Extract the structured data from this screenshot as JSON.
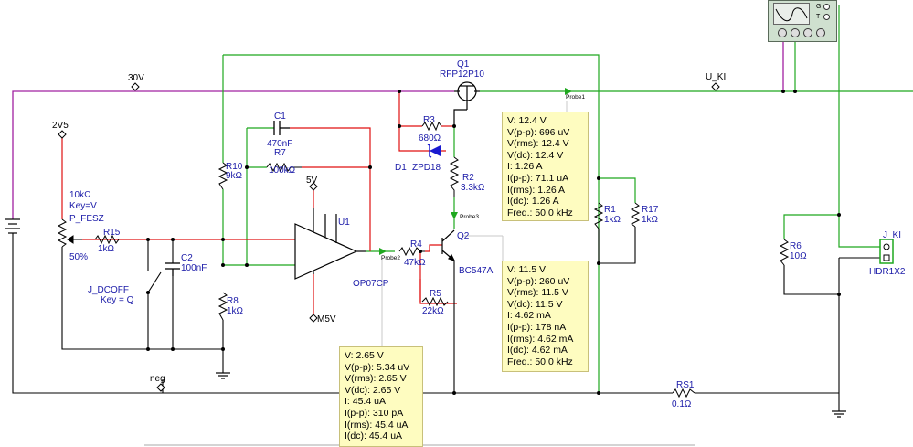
{
  "nets": {
    "net_30v": "30V",
    "net_2v5": "2V5",
    "net_u_ki": "U_KI",
    "net_neg": "neg",
    "net_5v": "5V",
    "net_m5v": "M5V"
  },
  "components": {
    "q1": {
      "ref": "Q1",
      "part": "RFP12P10"
    },
    "q2": {
      "ref": "Q2",
      "part": "BC547A"
    },
    "u1": {
      "ref": "U1",
      "part": "OP07CP"
    },
    "r3": {
      "ref": "R3",
      "value": "680Ω"
    },
    "d1": {
      "ref": "D1",
      "part": "ZPD18"
    },
    "r2": {
      "ref": "R2",
      "value": "3.3kΩ"
    },
    "c1": {
      "ref": "C1",
      "value": "470nF"
    },
    "r7": {
      "ref": "R7",
      "value": "100kΩ"
    },
    "r10": {
      "ref": "R10",
      "value": "9kΩ"
    },
    "r8": {
      "ref": "R8",
      "value": "1kΩ"
    },
    "r15": {
      "ref": "R15",
      "value": "1kΩ"
    },
    "c2": {
      "ref": "C2",
      "value": "100nF"
    },
    "r4": {
      "ref": "R4",
      "value": "47kΩ"
    },
    "r5": {
      "ref": "R5",
      "value": "22kΩ"
    },
    "r1": {
      "ref": "R1",
      "value": "1kΩ"
    },
    "r17": {
      "ref": "R17",
      "value": "1kΩ"
    },
    "r6": {
      "ref": "R6",
      "value": "10Ω"
    },
    "rs1": {
      "ref": "RS1",
      "value": "0.1Ω"
    },
    "pot": {
      "value": "10kΩ",
      "key": "Key=V",
      "ref": "P_FESZ",
      "setting": "50%"
    },
    "sw": {
      "ref": "J_DCOFF",
      "key": "Key = Q"
    },
    "conn": {
      "ref": "J_KI",
      "part": "HDR1X2"
    }
  },
  "probe_tags": {
    "p1": "Probe1",
    "p2": "Probe2",
    "p3": "Probe3"
  },
  "scope": {
    "t1": "G",
    "t2": "T"
  },
  "probe1": [
    "V: 12.4 V",
    "V(p-p): 696 uV",
    "V(rms): 12.4 V",
    "V(dc): 12.4 V",
    "I: 1.26 A",
    "I(p-p): 71.1 uA",
    "I(rms): 1.26 A",
    "I(dc): 1.26 A",
    "Freq.: 50.0 kHz"
  ],
  "probe2": [
    "V: 2.65 V",
    "V(p-p): 5.34 uV",
    "V(rms): 2.65 V",
    "V(dc): 2.65 V",
    "I: 45.4 uA",
    "I(p-p): 310 pA",
    "I(rms): 45.4 uA",
    "I(dc): 45.4 uA"
  ],
  "probe3": [
    "V: 11.5 V",
    "V(p-p): 260 uV",
    "V(rms): 11.5 V",
    "V(dc): 11.5 V",
    "I: 4.62 mA",
    "I(p-p): 178 nA",
    "I(rms): 4.62 mA",
    "I(dc): 4.62 mA",
    "Freq.: 50.0 kHz"
  ],
  "colors": {
    "wire_black": "#000000",
    "wire_green": "#1fa81f",
    "wire_red": "#e01010",
    "wire_magenta": "#a020a0",
    "probe_bg": "#fefcc0",
    "label_blue": "#1a1aa8"
  }
}
